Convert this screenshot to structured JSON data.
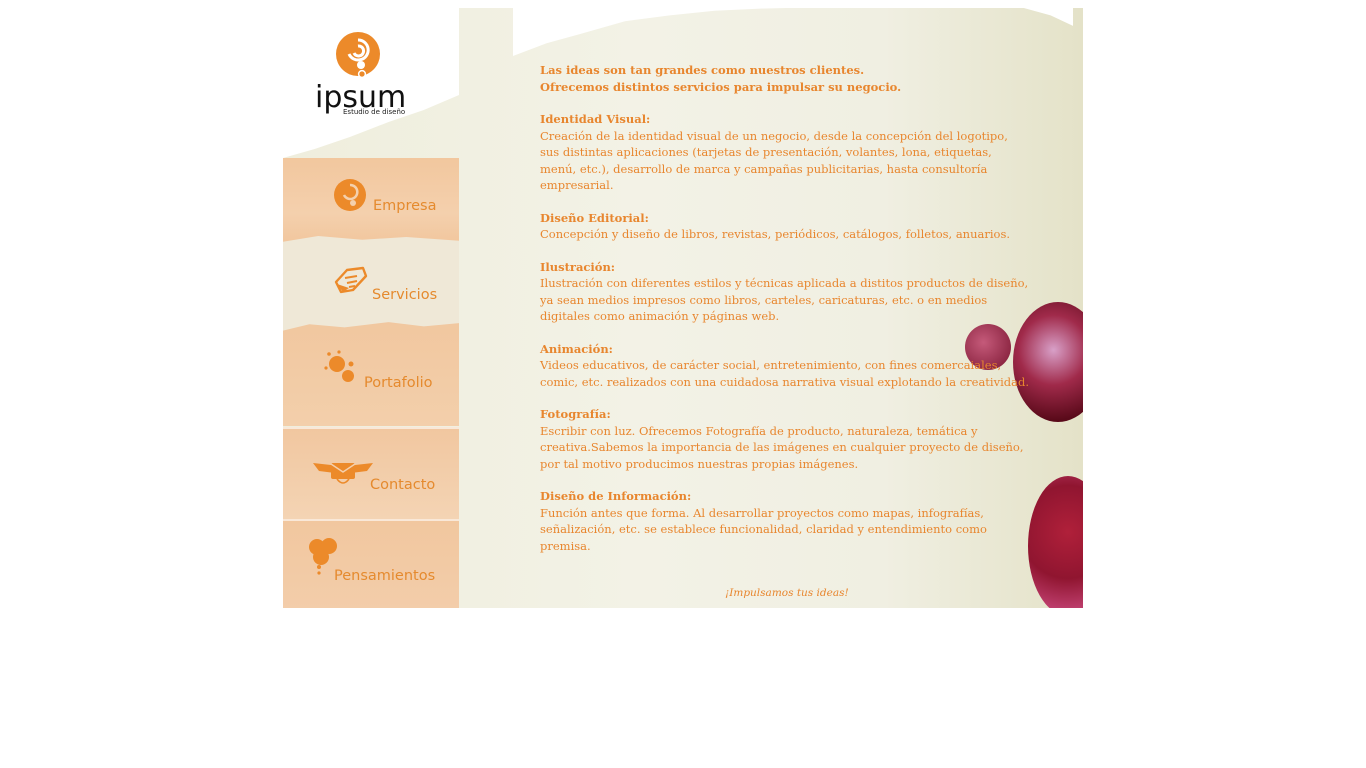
{
  "brand": {
    "name": "ipsum",
    "tagline": "Estudio de diseño"
  },
  "nav": {
    "items": [
      {
        "label": "Empresa",
        "icon": "swirl-icon"
      },
      {
        "label": "Servicios",
        "icon": "handshake-icon"
      },
      {
        "label": "Portafolio",
        "icon": "paint-drops-icon"
      },
      {
        "label": "Contacto",
        "icon": "winged-envelope-icon"
      },
      {
        "label": "Pensamientos",
        "icon": "flower-icon"
      }
    ]
  },
  "content": {
    "intro_line1": "Las ideas son tan grandes como nuestros clientes.",
    "intro_line2": "Ofrecemos distintos servicios para impulsar su negocio.",
    "sections": [
      {
        "title": "Identidad Visual:",
        "body": "Creación de la identidad visual de un negocio, desde la concepción del logotipo, sus distintas aplicaciones  (tarjetas de presentación, volantes, lona, etiquetas, menú, etc.), desarrollo  de marca y campañas publicitarias, hasta consultoría empresarial."
      },
      {
        "title": "Diseño Editorial:",
        "body": "Concepción y diseño de libros, revistas, periódicos, catálogos, folletos, anuarios."
      },
      {
        "title": "Ilustración:",
        "body": "Ilustración con diferentes estilos y técnicas aplicada a distitos productos de diseño, ya sean medios impresos como libros, carteles, caricaturas, etc. o en medios digitales como animación y páginas web."
      },
      {
        "title": "Animación:",
        "body": "Videos educativos, de carácter social, entretenimiento, con fines comercaiales, comic, etc. realizados con una cuidadosa narrativa visual explotando la creatividad."
      },
      {
        "title": "Fotografía:",
        "body": "Escribir con luz. Ofrecemos Fotografía de producto, naturaleza, temática y creativa.Sabemos la importancia de las imágenes en cualquier proyecto de diseño, por tal motivo producimos nuestras propias imágenes."
      },
      {
        "title": "Diseño de Información:",
        "body": "Función antes que forma. Al desarrollar proyectos como mapas, infografías, señalización, etc. se establece funcionalidad, claridad y entendimiento como premisa."
      }
    ],
    "footer": "¡Impulsamos tus ideas!"
  },
  "colors": {
    "accent": "#e8862e",
    "sidebar_peach": "#f2c79e",
    "paper": "#f1f0e3",
    "blob_red": "#8a1a2a",
    "blob_pink": "#c2456a"
  }
}
